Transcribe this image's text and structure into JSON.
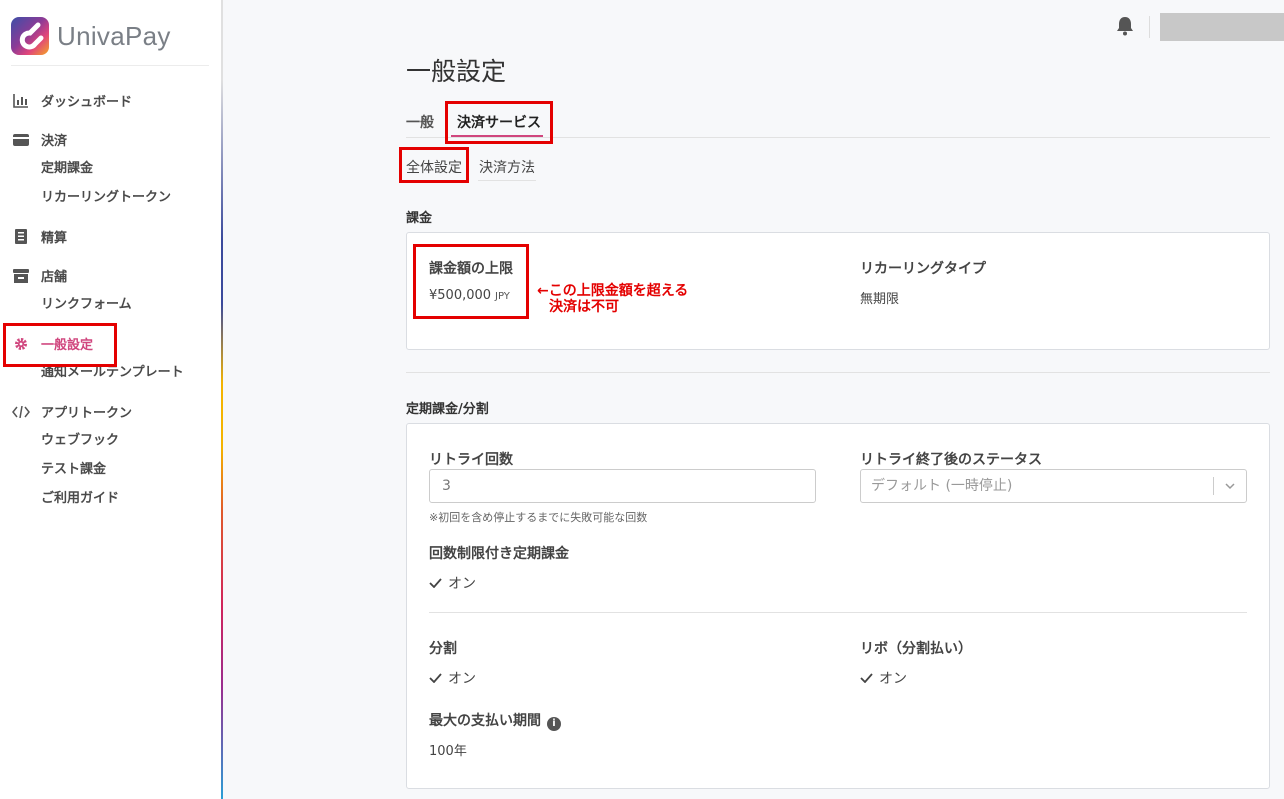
{
  "app": {
    "logo_text": "UnivaPay"
  },
  "sidebar": {
    "items": [
      {
        "type": "group",
        "label": "ダッシュボード",
        "icon": "bar-chart-icon"
      },
      {
        "type": "group",
        "label": "決済",
        "icon": "credit-card-icon"
      },
      {
        "type": "sub",
        "label": "定期課金"
      },
      {
        "type": "sub",
        "label": "リカーリングトークン"
      },
      {
        "type": "group",
        "label": "精算",
        "icon": "receipt-icon"
      },
      {
        "type": "group",
        "label": "店舗",
        "icon": "store-icon"
      },
      {
        "type": "sub",
        "label": "リンクフォーム"
      },
      {
        "type": "group",
        "label": "一般設定",
        "icon": "gear-icon",
        "active": true
      },
      {
        "type": "sub",
        "label": "通知メールテンプレート"
      },
      {
        "type": "group",
        "label": "アプリトークン",
        "icon": "code-icon"
      },
      {
        "type": "sub",
        "label": "ウェブフック"
      },
      {
        "type": "sub",
        "label": "テスト課金"
      },
      {
        "type": "sub",
        "label": "ご利用ガイド"
      }
    ]
  },
  "page": {
    "title": "一般設定",
    "tabs": [
      {
        "label": "一般"
      },
      {
        "label": "決済サービス",
        "active": true
      }
    ],
    "subtabs": [
      {
        "label": "全体設定",
        "active": true
      },
      {
        "label": "決済方法"
      }
    ]
  },
  "charge": {
    "section_title": "課金",
    "max_amount_label": "課金額の上限",
    "max_amount_value": "¥500,000",
    "max_amount_unit": "JPY",
    "recurring_type_label": "リカーリングタイプ",
    "recurring_type_value": "無期限",
    "annotation_line1": "←この上限金額を超える",
    "annotation_line2": "決済は不可"
  },
  "subscription": {
    "section_title": "定期課金/分割",
    "retry_count_label": "リトライ回数",
    "retry_count_value": "3",
    "retry_hint": "※初回を含め停止するまでに失敗可能な回数",
    "retry_status_label": "リトライ終了後のステータス",
    "retry_status_placeholder": "デフォルト (一時停止)",
    "limited_label": "回数制限付き定期課金",
    "limited_value": "オン",
    "installment_label": "分割",
    "installment_value": "オン",
    "revolving_label": "リボ（分割払い）",
    "revolving_value": "オン",
    "max_period_label": "最大の支払い期間",
    "max_period_value": "100年"
  },
  "colors": {
    "accent": "#d0467e",
    "highlight": "#e40000"
  }
}
